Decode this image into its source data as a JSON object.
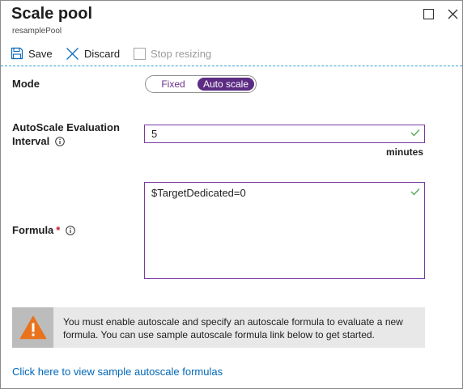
{
  "header": {
    "title": "Scale pool",
    "subtitle": "resamplePool"
  },
  "toolbar": {
    "save_label": "Save",
    "discard_label": "Discard",
    "stop_resizing_label": "Stop resizing"
  },
  "mode": {
    "label": "Mode",
    "options": [
      "Fixed",
      "Auto scale"
    ],
    "selected": "Auto scale"
  },
  "interval": {
    "label_line1": "AutoScale Evaluation",
    "label_line2": "Interval",
    "value": "5",
    "units": "minutes"
  },
  "formula": {
    "label": "Formula",
    "required_mark": "*",
    "value": "$TargetDedicated=0"
  },
  "warning": {
    "text": "You must enable autoscale and specify an autoscale formula to evaluate a new formula. You can use sample autoscale formula link below to get started."
  },
  "sample_link": {
    "text": "Click here to view sample autoscale formulas"
  },
  "colors": {
    "accent": "#5c2b83",
    "input_border": "#7a3aa1",
    "link": "#0067b8",
    "warning_orange": "#e9731c",
    "check_green": "#5aa85a",
    "toolbar_icon_blue": "#0b6cbd"
  },
  "icons": {
    "save": "save-icon",
    "discard": "close-x-icon",
    "maximize": "maximize-icon",
    "close": "close-icon",
    "info": "info-icon",
    "check": "check-icon",
    "warning": "warning-triangle-icon"
  }
}
